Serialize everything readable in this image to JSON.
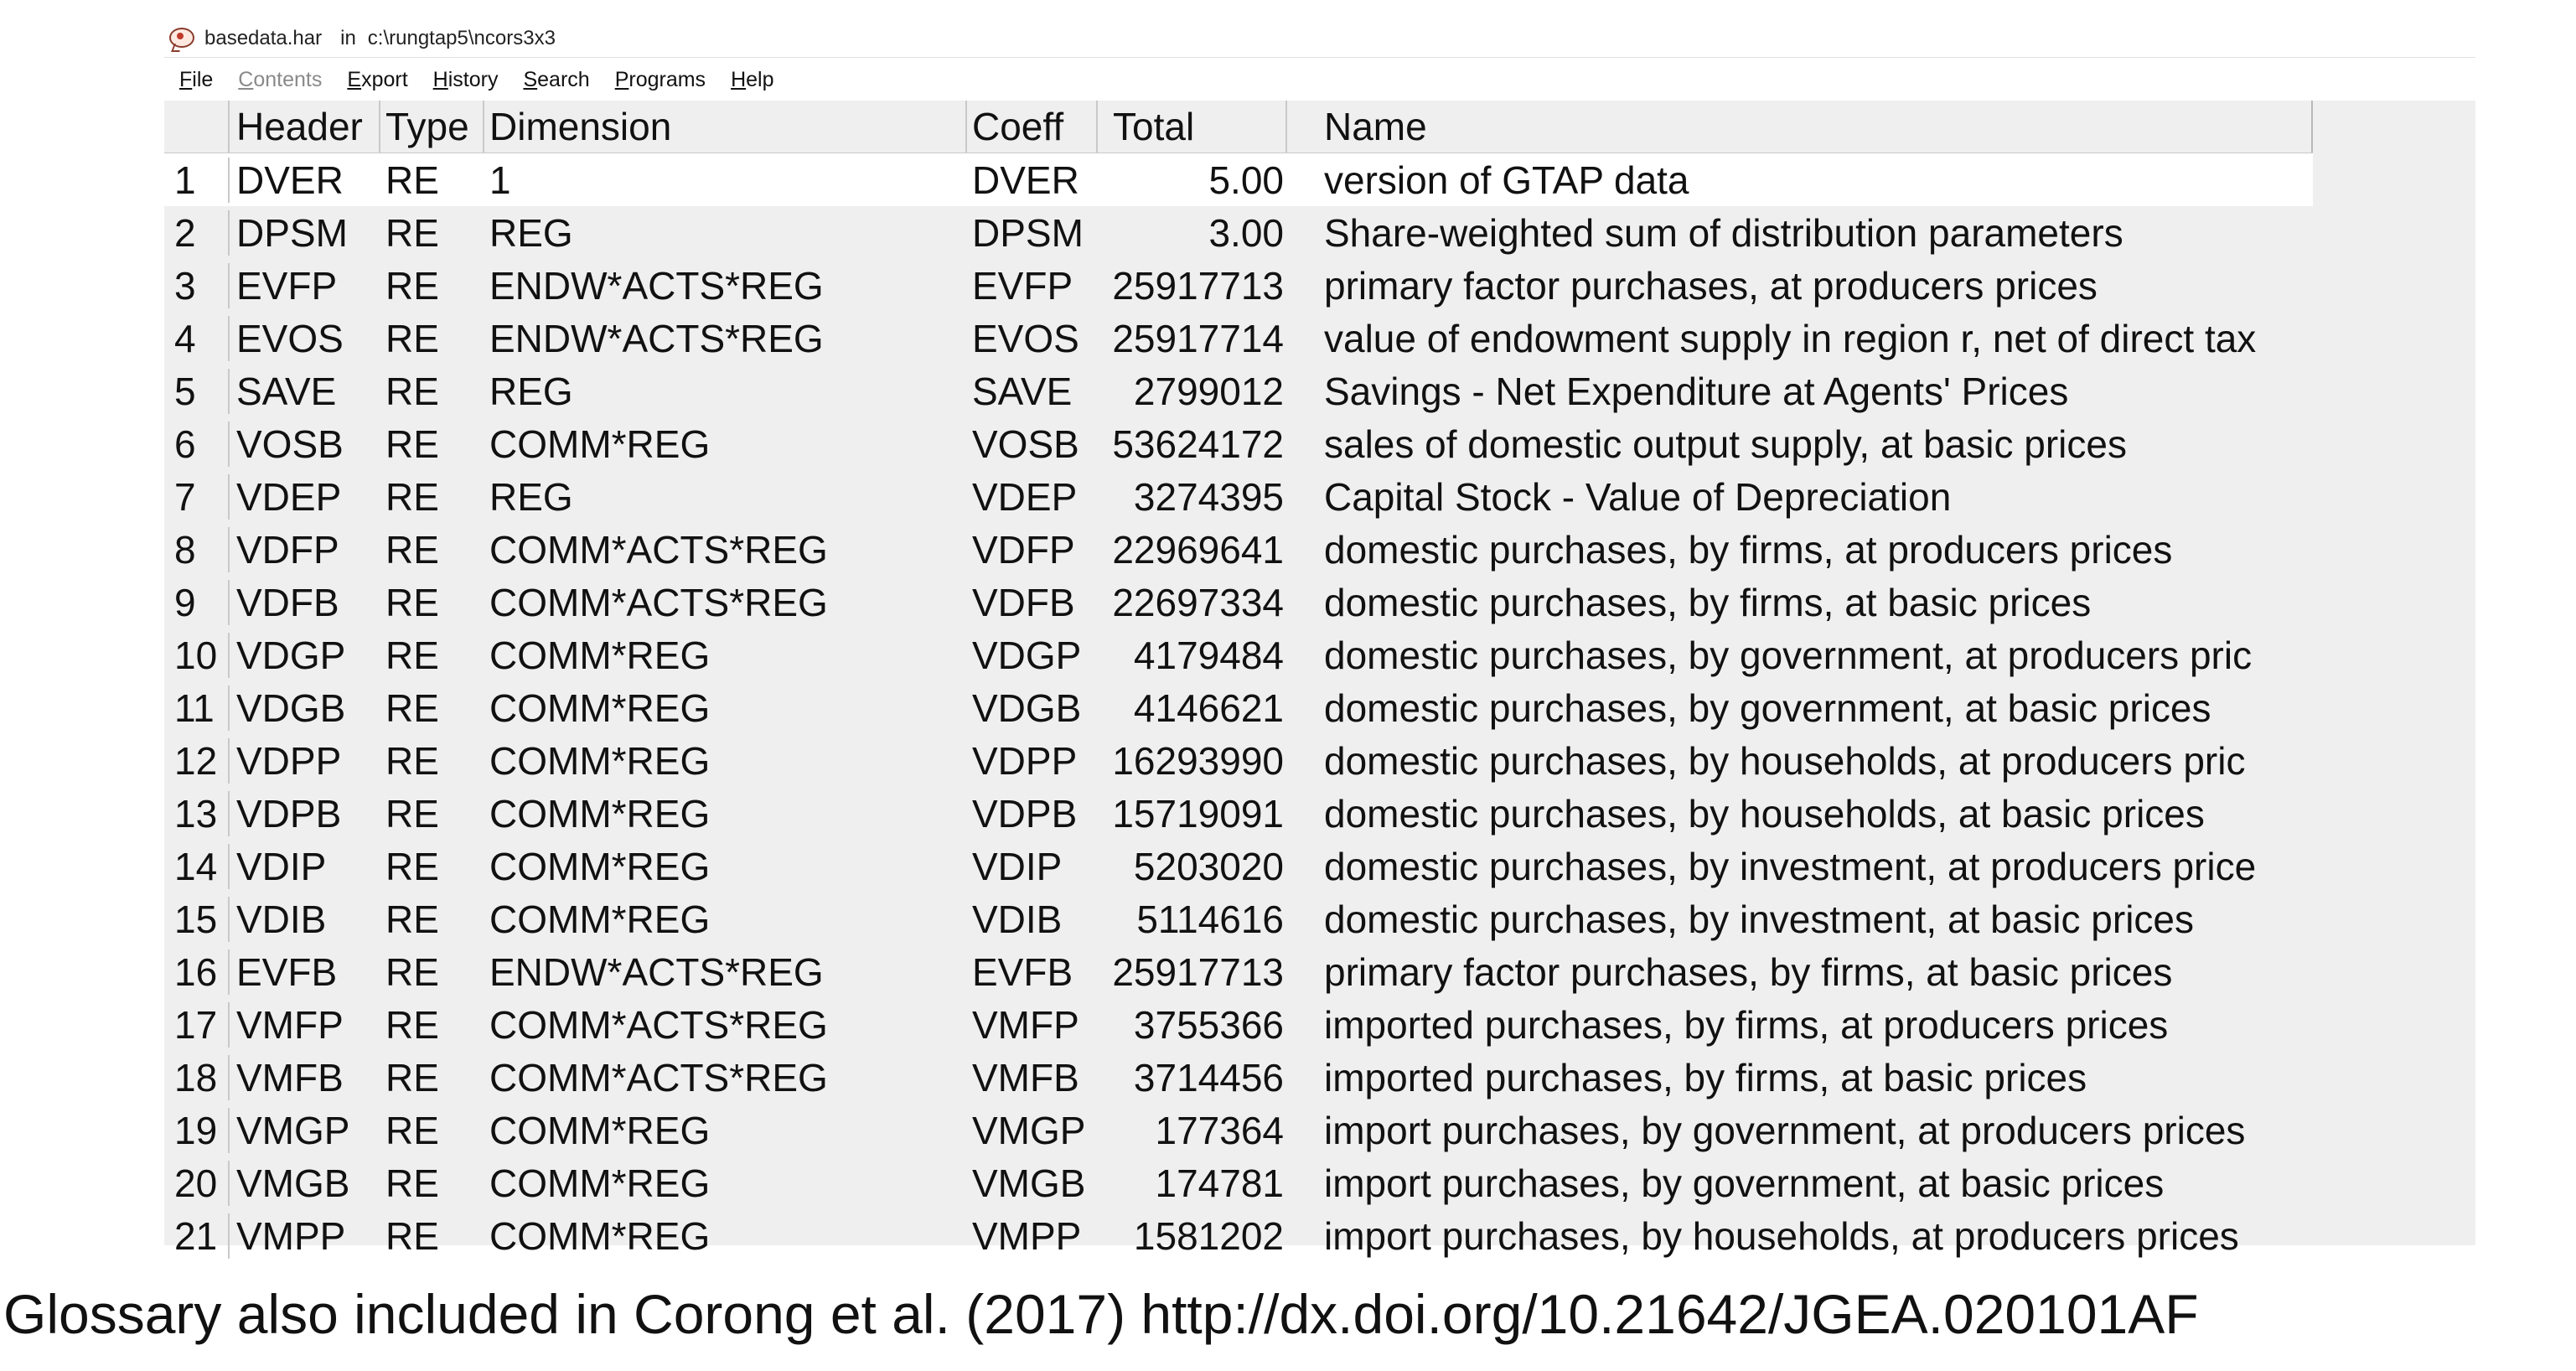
{
  "window": {
    "file_name": "basedata.har",
    "in_label": "in",
    "path": "c:\\rungtap5\\ncors3x3"
  },
  "menu": [
    {
      "label": "File",
      "enabled": true
    },
    {
      "label": "Contents",
      "enabled": false
    },
    {
      "label": "Export",
      "enabled": true
    },
    {
      "label": "History",
      "enabled": true
    },
    {
      "label": "Search",
      "enabled": true
    },
    {
      "label": "Programs",
      "enabled": true
    },
    {
      "label": "Help",
      "enabled": true
    }
  ],
  "table": {
    "columns": {
      "header": "Header",
      "type": "Type",
      "dimension": "Dimension",
      "coeff": "Coeff",
      "total": "Total",
      "name": "Name"
    },
    "selected_row": 1,
    "rows": [
      {
        "num": "1",
        "header": "DVER",
        "type": "RE",
        "dimension": "1",
        "coeff": "DVER",
        "total": "5.00",
        "name": "version of GTAP data"
      },
      {
        "num": "2",
        "header": "DPSM",
        "type": "RE",
        "dimension": "REG",
        "coeff": "DPSM",
        "total": "3.00",
        "name": "Share-weighted sum of distribution parameters"
      },
      {
        "num": "3",
        "header": "EVFP",
        "type": "RE",
        "dimension": "ENDW*ACTS*REG",
        "coeff": "EVFP",
        "total": "25917713",
        "name": "primary factor purchases, at producers prices"
      },
      {
        "num": "4",
        "header": "EVOS",
        "type": "RE",
        "dimension": "ENDW*ACTS*REG",
        "coeff": "EVOS",
        "total": "25917714",
        "name": "value of endowment supply in region r, net of direct tax"
      },
      {
        "num": "5",
        "header": "SAVE",
        "type": "RE",
        "dimension": "REG",
        "coeff": "SAVE",
        "total": "2799012",
        "name": "Savings - Net Expenditure at Agents' Prices"
      },
      {
        "num": "6",
        "header": "VOSB",
        "type": "RE",
        "dimension": "COMM*REG",
        "coeff": "VOSB",
        "total": "53624172",
        "name": "sales of domestic output supply, at basic prices"
      },
      {
        "num": "7",
        "header": "VDEP",
        "type": "RE",
        "dimension": "REG",
        "coeff": "VDEP",
        "total": "3274395",
        "name": "Capital Stock - Value of Depreciation"
      },
      {
        "num": "8",
        "header": "VDFP",
        "type": "RE",
        "dimension": "COMM*ACTS*REG",
        "coeff": "VDFP",
        "total": "22969641",
        "name": "domestic purchases, by firms, at producers prices"
      },
      {
        "num": "9",
        "header": "VDFB",
        "type": "RE",
        "dimension": "COMM*ACTS*REG",
        "coeff": "VDFB",
        "total": "22697334",
        "name": "domestic purchases, by firms, at basic prices"
      },
      {
        "num": "10",
        "header": "VDGP",
        "type": "RE",
        "dimension": "COMM*REG",
        "coeff": "VDGP",
        "total": "4179484",
        "name": "domestic purchases, by government, at producers pric"
      },
      {
        "num": "11",
        "header": "VDGB",
        "type": "RE",
        "dimension": "COMM*REG",
        "coeff": "VDGB",
        "total": "4146621",
        "name": "domestic purchases, by government, at basic prices"
      },
      {
        "num": "12",
        "header": "VDPP",
        "type": "RE",
        "dimension": "COMM*REG",
        "coeff": "VDPP",
        "total": "16293990",
        "name": "domestic purchases, by households, at producers pric"
      },
      {
        "num": "13",
        "header": "VDPB",
        "type": "RE",
        "dimension": "COMM*REG",
        "coeff": "VDPB",
        "total": "15719091",
        "name": "domestic purchases, by households, at basic prices"
      },
      {
        "num": "14",
        "header": "VDIP",
        "type": "RE",
        "dimension": "COMM*REG",
        "coeff": "VDIP",
        "total": "5203020",
        "name": "domestic purchases, by investment, at producers price"
      },
      {
        "num": "15",
        "header": "VDIB",
        "type": "RE",
        "dimension": "COMM*REG",
        "coeff": "VDIB",
        "total": "5114616",
        "name": "domestic purchases, by investment, at basic prices"
      },
      {
        "num": "16",
        "header": "EVFB",
        "type": "RE",
        "dimension": "ENDW*ACTS*REG",
        "coeff": "EVFB",
        "total": "25917713",
        "name": "primary factor purchases, by firms, at basic prices"
      },
      {
        "num": "17",
        "header": "VMFP",
        "type": "RE",
        "dimension": "COMM*ACTS*REG",
        "coeff": "VMFP",
        "total": "3755366",
        "name": "imported purchases, by firms, at producers prices"
      },
      {
        "num": "18",
        "header": "VMFB",
        "type": "RE",
        "dimension": "COMM*ACTS*REG",
        "coeff": "VMFB",
        "total": "3714456",
        "name": "imported purchases, by firms, at basic prices"
      },
      {
        "num": "19",
        "header": "VMGP",
        "type": "RE",
        "dimension": "COMM*REG",
        "coeff": "VMGP",
        "total": "177364",
        "name": "import purchases, by government, at producers prices"
      },
      {
        "num": "20",
        "header": "VMGB",
        "type": "RE",
        "dimension": "COMM*REG",
        "coeff": "VMGB",
        "total": "174781",
        "name": "import purchases, by government, at basic prices"
      },
      {
        "num": "21",
        "header": "VMPP",
        "type": "RE",
        "dimension": "COMM*REG",
        "coeff": "VMPP",
        "total": "1581202",
        "name": "import purchases, by households, at producers prices"
      }
    ]
  },
  "caption": "Glossary also included in Corong et al. (2017) http://dx.doi.org/10.21642/JGEA.020101AF"
}
